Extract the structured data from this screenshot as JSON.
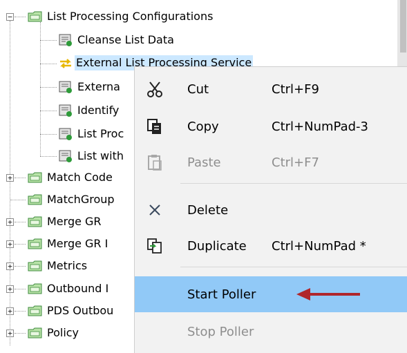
{
  "tree": {
    "items": [
      {
        "label": "List Processing Configurations",
        "icon": "folder-icon",
        "expander": "−"
      },
      {
        "label": "Cleanse List Data",
        "icon": "config-icon"
      },
      {
        "label": "External List Processing Service",
        "icon": "exchange-arrows-icon"
      },
      {
        "label": "Externa",
        "icon": "config-icon"
      },
      {
        "label": "Identify",
        "icon": "config-icon"
      },
      {
        "label": "List Proc",
        "icon": "config-icon"
      },
      {
        "label": "List with",
        "icon": "config-icon"
      },
      {
        "label": "Match Code",
        "icon": "folder-icon",
        "expander": "+"
      },
      {
        "label": "MatchGroup",
        "icon": "folder-icon"
      },
      {
        "label": "Merge GR",
        "icon": "folder-icon",
        "expander": "+"
      },
      {
        "label": "Merge GR I",
        "icon": "folder-icon",
        "expander": "+"
      },
      {
        "label": "Metrics",
        "icon": "folder-icon",
        "expander": "+"
      },
      {
        "label": "Outbound I",
        "icon": "folder-icon",
        "expander": "+"
      },
      {
        "label": "PDS Outbou",
        "icon": "folder-icon",
        "expander": "+"
      },
      {
        "label": "Policy",
        "icon": "folder-icon",
        "expander": "+"
      }
    ]
  },
  "context_menu": {
    "items": [
      {
        "label": "Cut",
        "shortcut": "Ctrl+F9",
        "icon": "scissors-icon",
        "enabled": true
      },
      {
        "label": "Copy",
        "shortcut": "Ctrl+NumPad-3",
        "icon": "copy-icon",
        "enabled": true
      },
      {
        "label": "Paste",
        "shortcut": "Ctrl+F7",
        "icon": "paste-icon",
        "enabled": false
      },
      {
        "label": "Delete",
        "shortcut": "",
        "icon": "delete-x-icon",
        "enabled": true
      },
      {
        "label": "Duplicate",
        "shortcut": "Ctrl+NumPad *",
        "icon": "duplicate-icon",
        "enabled": true
      },
      {
        "label": "Start Poller",
        "shortcut": "",
        "icon": "",
        "enabled": true,
        "highlighted": true
      },
      {
        "label": "Stop Poller",
        "shortcut": "",
        "icon": "",
        "enabled": false
      }
    ]
  },
  "annotation": {
    "arrow_color": "#b0262b"
  },
  "colors": {
    "selection": "#cce8ff",
    "menu_highlight": "#91c9f7",
    "menu_bg": "#f2f2f2"
  }
}
